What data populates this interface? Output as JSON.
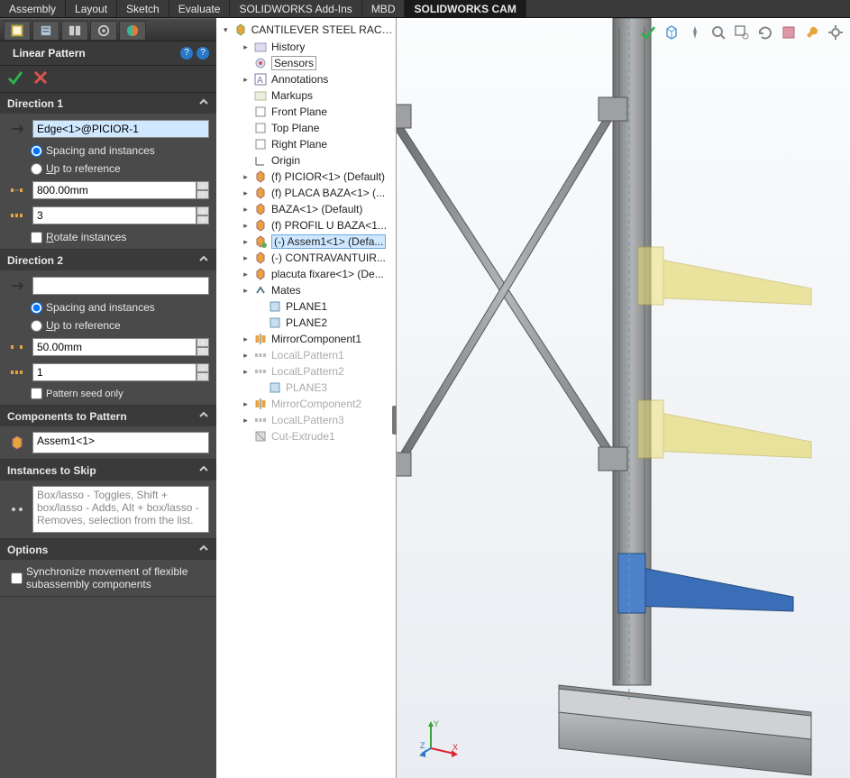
{
  "tabs": [
    "Assembly",
    "Layout",
    "Sketch",
    "Evaluate",
    "SOLIDWORKS Add-Ins",
    "MBD",
    "SOLIDWORKS CAM"
  ],
  "tabs_active": 6,
  "pm": {
    "title": "Linear Pattern",
    "dir1": {
      "title": "Direction 1",
      "edge": "Edge<1>@PICIOR-1",
      "radio_spacing": "Spacing and instances",
      "radio_ref": "Up to reference",
      "spacing": "800.00mm",
      "instances": "3",
      "rotate": "Rotate instances"
    },
    "dir2": {
      "title": "Direction 2",
      "edge": "",
      "radio_spacing": "Spacing and instances",
      "radio_ref": "Up to reference",
      "spacing": "50.00mm",
      "instances": "1",
      "seed_only": "Pattern seed only"
    },
    "comps": {
      "title": "Components to Pattern",
      "item": "Assem1<1>"
    },
    "skip": {
      "title": "Instances to Skip",
      "hint": "Box/lasso - Toggles, Shift + box/lasso - Adds, Alt + box/lasso - Removes, selection from the list."
    },
    "options": {
      "title": "Options",
      "sync": "Synchronize movement of flexible subassembly components"
    }
  },
  "tree": {
    "root": "CANTILEVER STEEL RACK ...",
    "items": [
      {
        "depth": 1,
        "icon": "history",
        "label": "History",
        "exp": true
      },
      {
        "depth": 1,
        "icon": "sensor",
        "label": "Sensors",
        "boxed": true
      },
      {
        "depth": 1,
        "icon": "annot",
        "label": "Annotations",
        "exp": true
      },
      {
        "depth": 1,
        "icon": "markup",
        "label": "Markups"
      },
      {
        "depth": 1,
        "icon": "plane",
        "label": "Front Plane"
      },
      {
        "depth": 1,
        "icon": "plane",
        "label": "Top Plane"
      },
      {
        "depth": 1,
        "icon": "plane",
        "label": "Right Plane"
      },
      {
        "depth": 1,
        "icon": "origin",
        "label": "Origin"
      },
      {
        "depth": 1,
        "icon": "part",
        "label": "(f) PICIOR<1> (Default)",
        "exp": true
      },
      {
        "depth": 1,
        "icon": "part",
        "label": "(f) PLACA BAZA<1> (...",
        "exp": true
      },
      {
        "depth": 1,
        "icon": "part",
        "label": "BAZA<1> (Default)",
        "exp": true
      },
      {
        "depth": 1,
        "icon": "part",
        "label": "(f) PROFIL U BAZA<1...",
        "exp": true
      },
      {
        "depth": 1,
        "icon": "asm",
        "label": "(-) Assem1<1> (Defa...",
        "exp": true,
        "selected": true
      },
      {
        "depth": 1,
        "icon": "part",
        "label": "(-) CONTRAVANTUIR...",
        "exp": true
      },
      {
        "depth": 1,
        "icon": "part",
        "label": "placuta fixare<1> (De...",
        "exp": true
      },
      {
        "depth": 1,
        "icon": "mates",
        "label": "Mates",
        "exp": true
      },
      {
        "depth": 2,
        "icon": "plane2",
        "label": "PLANE1"
      },
      {
        "depth": 2,
        "icon": "plane2",
        "label": "PLANE2"
      },
      {
        "depth": 1,
        "icon": "mirror",
        "label": "MirrorComponent1",
        "exp": true
      },
      {
        "depth": 1,
        "icon": "lpat",
        "label": "LocalLPattern1",
        "exp": true,
        "suppressed": true
      },
      {
        "depth": 1,
        "icon": "lpat",
        "label": "LocalLPattern2",
        "exp": true,
        "suppressed": true
      },
      {
        "depth": 2,
        "icon": "plane2",
        "label": "PLANE3",
        "suppressed": true
      },
      {
        "depth": 1,
        "icon": "mirror",
        "label": "MirrorComponent2",
        "exp": true,
        "suppressed": true
      },
      {
        "depth": 1,
        "icon": "lpat",
        "label": "LocalLPattern3",
        "exp": true,
        "suppressed": true
      },
      {
        "depth": 1,
        "icon": "cut",
        "label": "Cut-Extrude1",
        "suppressed": true
      }
    ]
  },
  "hud_icons": [
    "check",
    "cube",
    "pin",
    "zoom-fit",
    "zoom-area",
    "rebuild",
    "book",
    "wrench",
    "gear"
  ],
  "colors": {
    "selected": "#cfe8ff",
    "accent": "#2a78c7",
    "ok": "#2bb24c",
    "cancel": "#d9534f",
    "arm": "#3a6fb8",
    "preview": "#e2d452"
  }
}
